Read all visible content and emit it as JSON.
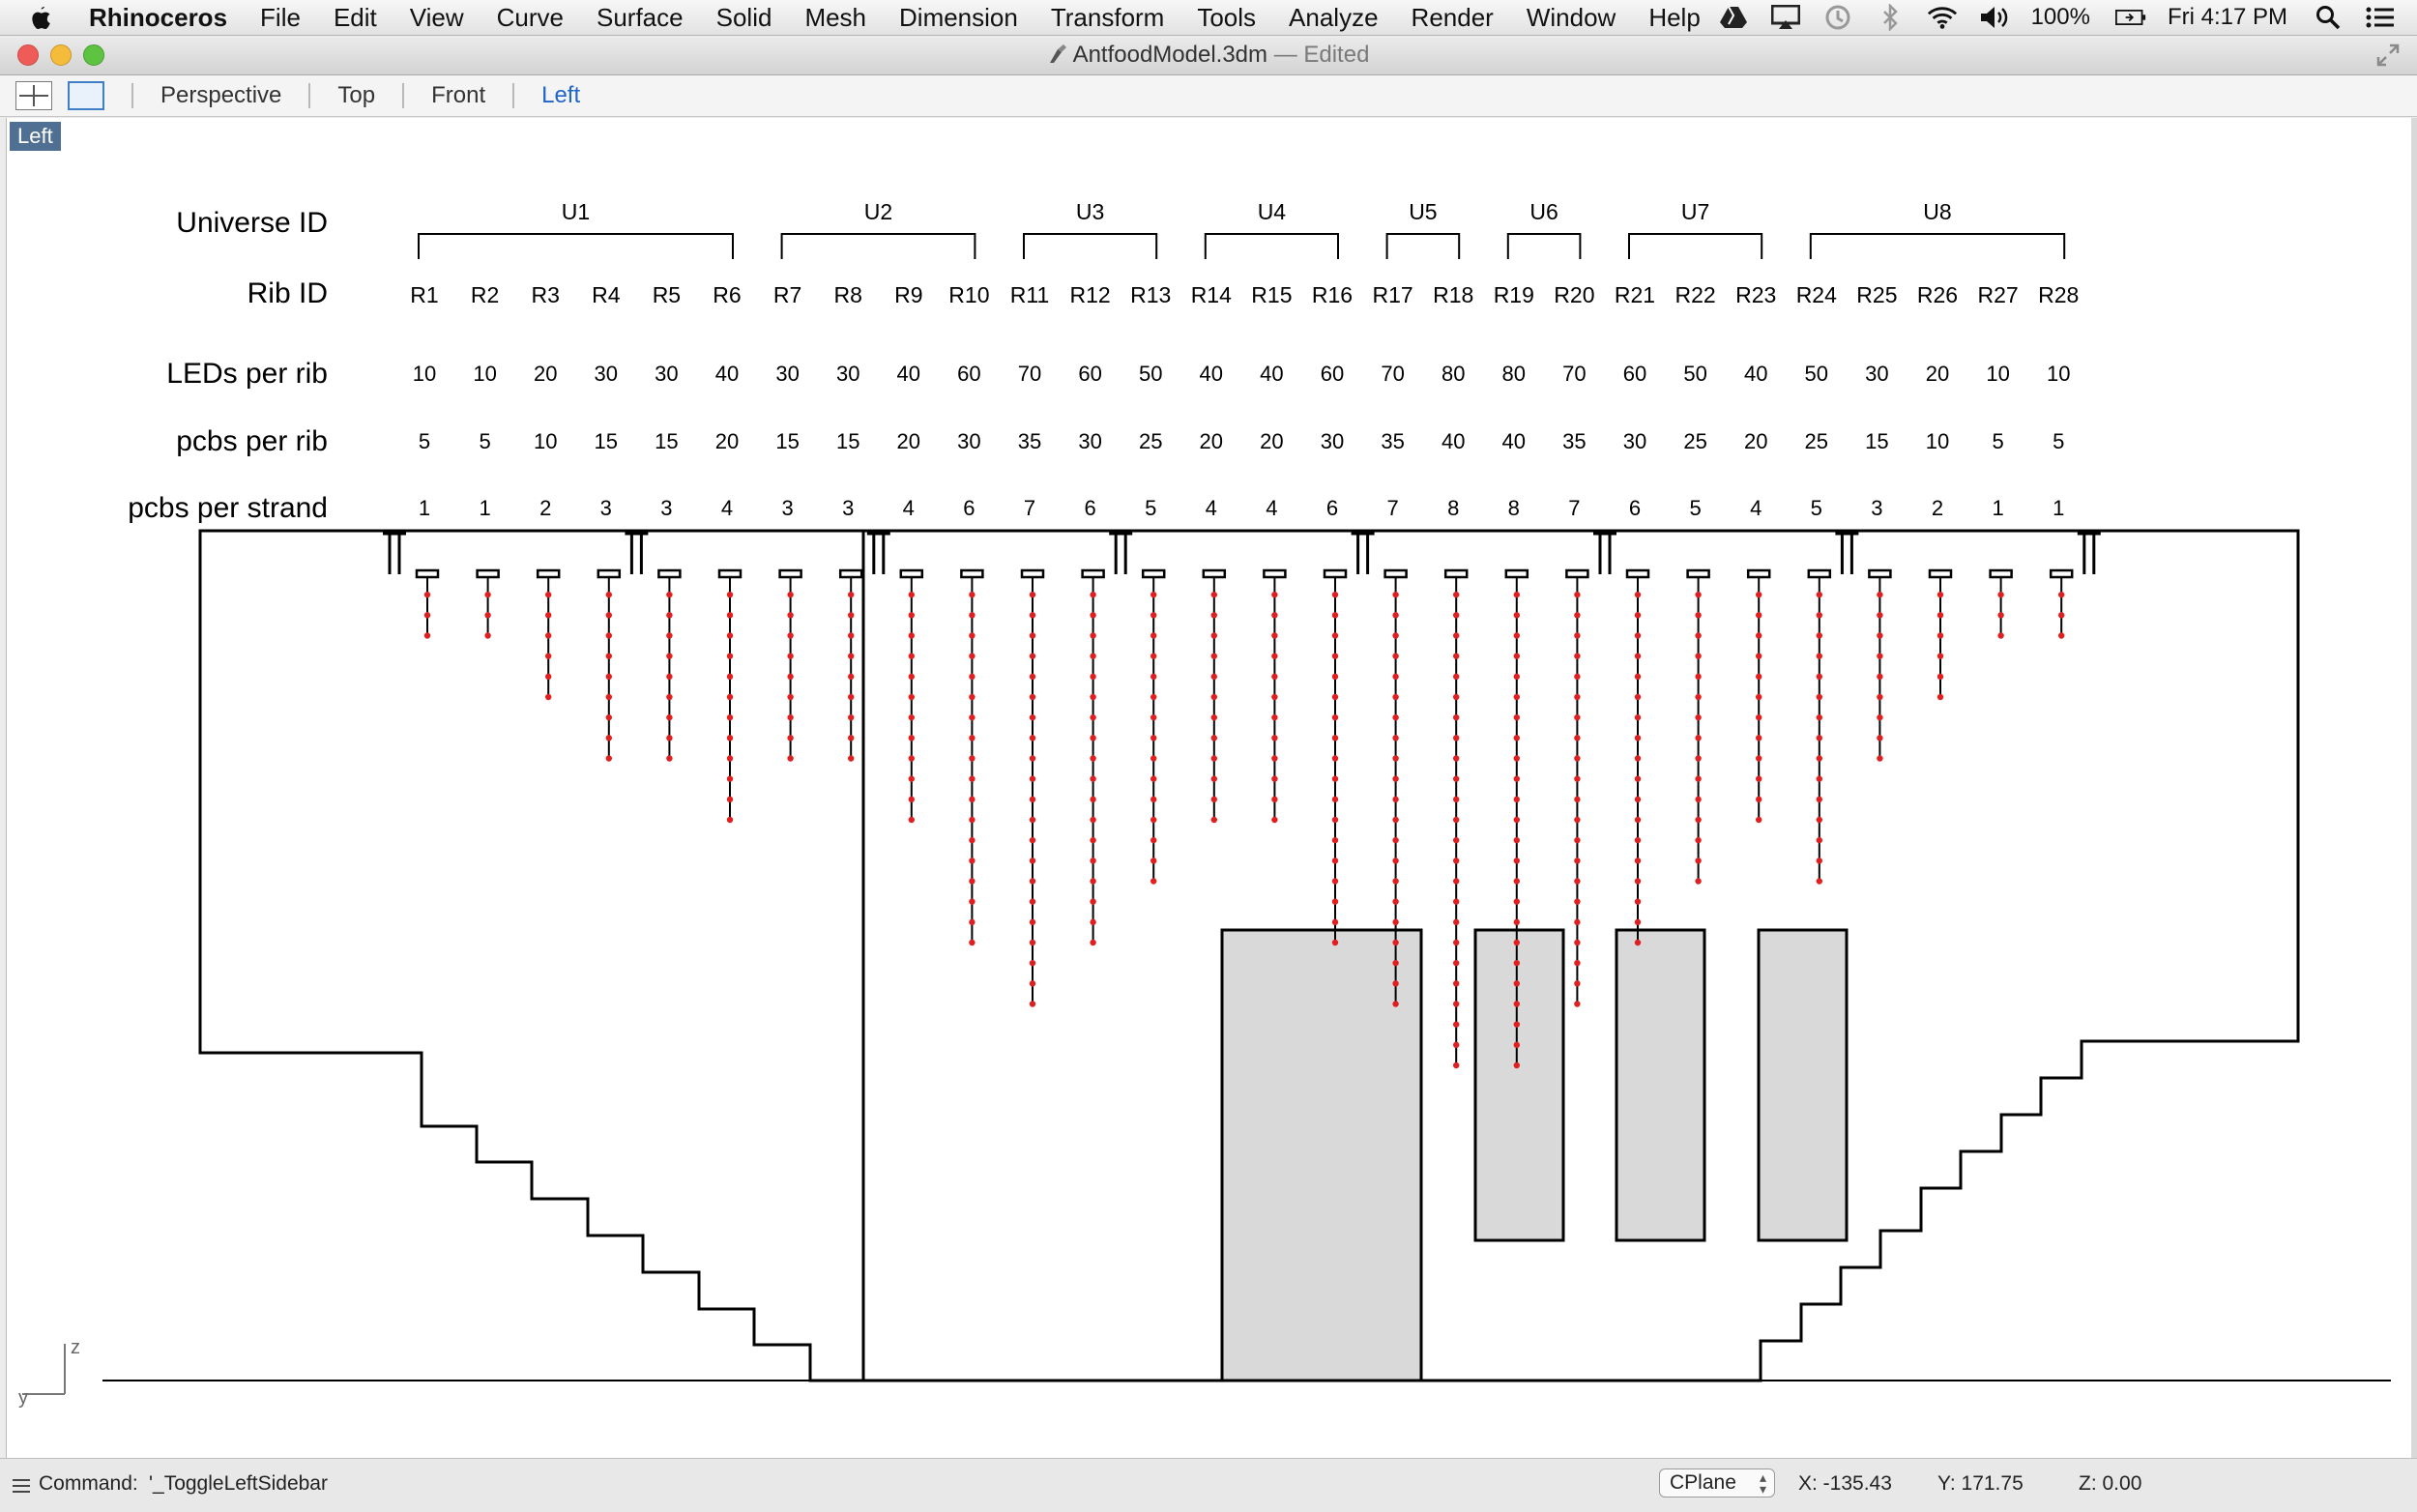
{
  "menubar": {
    "app": "Rhinoceros",
    "items": [
      "File",
      "Edit",
      "View",
      "Curve",
      "Surface",
      "Solid",
      "Mesh",
      "Dimension",
      "Transform",
      "Tools",
      "Analyze",
      "Render",
      "Window",
      "Help"
    ],
    "battery": "100%",
    "clock": "Fri 4:17 PM"
  },
  "window": {
    "filename": "AntfoodModel.3dm",
    "status": " — Edited"
  },
  "tabs": [
    "Perspective",
    "Top",
    "Front",
    "Left"
  ],
  "viewport": {
    "label": "Left",
    "axis_z": "z",
    "axis_y": "y"
  },
  "table": {
    "row_labels": {
      "universe": "Universe ID",
      "rib": "Rib ID",
      "leds": "LEDs per rib",
      "pcbs": "pcbs per rib",
      "strand": "pcbs per strand"
    },
    "universes": [
      {
        "label": "U1",
        "from": 0,
        "to": 5
      },
      {
        "label": "U2",
        "from": 6,
        "to": 9
      },
      {
        "label": "U3",
        "from": 10,
        "to": 12
      },
      {
        "label": "U4",
        "from": 13,
        "to": 15
      },
      {
        "label": "U5",
        "from": 16,
        "to": 17
      },
      {
        "label": "U6",
        "from": 18,
        "to": 19
      },
      {
        "label": "U7",
        "from": 20,
        "to": 22
      },
      {
        "label": "U8",
        "from": 23,
        "to": 27
      }
    ],
    "ribs": [
      "R1",
      "R2",
      "R3",
      "R4",
      "R5",
      "R6",
      "R7",
      "R8",
      "R9",
      "R10",
      "R11",
      "R12",
      "R13",
      "R14",
      "R15",
      "R16",
      "R17",
      "R18",
      "R19",
      "R20",
      "R21",
      "R22",
      "R23",
      "R24",
      "R25",
      "R26",
      "R27",
      "R28"
    ],
    "leds_per_rib": [
      10,
      10,
      20,
      30,
      30,
      40,
      30,
      30,
      40,
      60,
      70,
      60,
      50,
      40,
      40,
      60,
      70,
      80,
      80,
      70,
      60,
      50,
      40,
      50,
      30,
      20,
      10,
      10
    ],
    "pcbs_per_rib": [
      5,
      5,
      10,
      15,
      15,
      20,
      15,
      15,
      20,
      30,
      35,
      30,
      25,
      20,
      20,
      30,
      35,
      40,
      40,
      35,
      30,
      25,
      20,
      25,
      15,
      10,
      5,
      5
    ],
    "pcbs_per_strand": [
      1,
      1,
      2,
      3,
      3,
      4,
      3,
      3,
      4,
      6,
      7,
      6,
      5,
      4,
      4,
      6,
      7,
      8,
      8,
      7,
      6,
      5,
      4,
      5,
      3,
      2,
      1,
      1
    ]
  },
  "status": {
    "command_label": "Command:",
    "command_value": "'_ToggleLeftSidebar",
    "cplane": "CPlane",
    "x": "X: -135.43",
    "y": "Y: 171.75",
    "z": "Z: 0.00"
  }
}
